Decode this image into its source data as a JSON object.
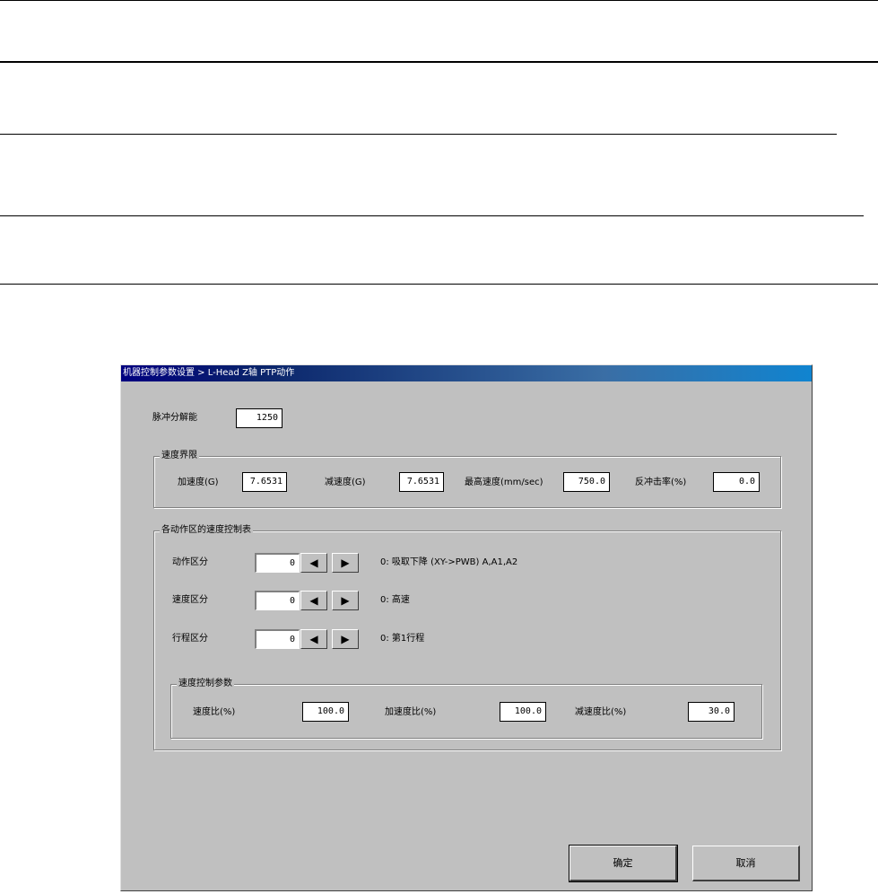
{
  "dialog": {
    "title": "机器控制参数设置 > L-Head Z轴 PTP动作",
    "pulse_resolution": {
      "label": "脉冲分解能",
      "value": "1250"
    },
    "speed_limit": {
      "legend": "速度界限",
      "accel_label": "加速度(G)",
      "accel_value": "7.6531",
      "decel_label": "减速度(G)",
      "decel_value": "7.6531",
      "max_speed_label": "最高速度(mm/sec)",
      "max_speed_value": "750.0",
      "rebound_label": "反冲击率(%)",
      "rebound_value": "0.0"
    },
    "speed_table": {
      "legend": "各动作区的速度控制表",
      "rows": [
        {
          "label": "动作区分",
          "value": "0",
          "desc": "0: 吸取下降 (XY->PWB) A,A1,A2"
        },
        {
          "label": "速度区分",
          "value": "0",
          "desc": "0: 高速"
        },
        {
          "label": "行程区分",
          "value": "0",
          "desc": "0: 第1行程"
        }
      ],
      "params": {
        "legend": "速度控制参数",
        "speed_ratio_label": "速度比(%)",
        "speed_ratio_value": "100.0",
        "accel_ratio_label": "加速度比(%)",
        "accel_ratio_value": "100.0",
        "decel_ratio_label": "减速度比(%)",
        "decel_ratio_value": "30.0"
      }
    },
    "ok_label": "确定",
    "cancel_label": "取消",
    "icons": {
      "left": "◀",
      "right": "▶"
    }
  }
}
